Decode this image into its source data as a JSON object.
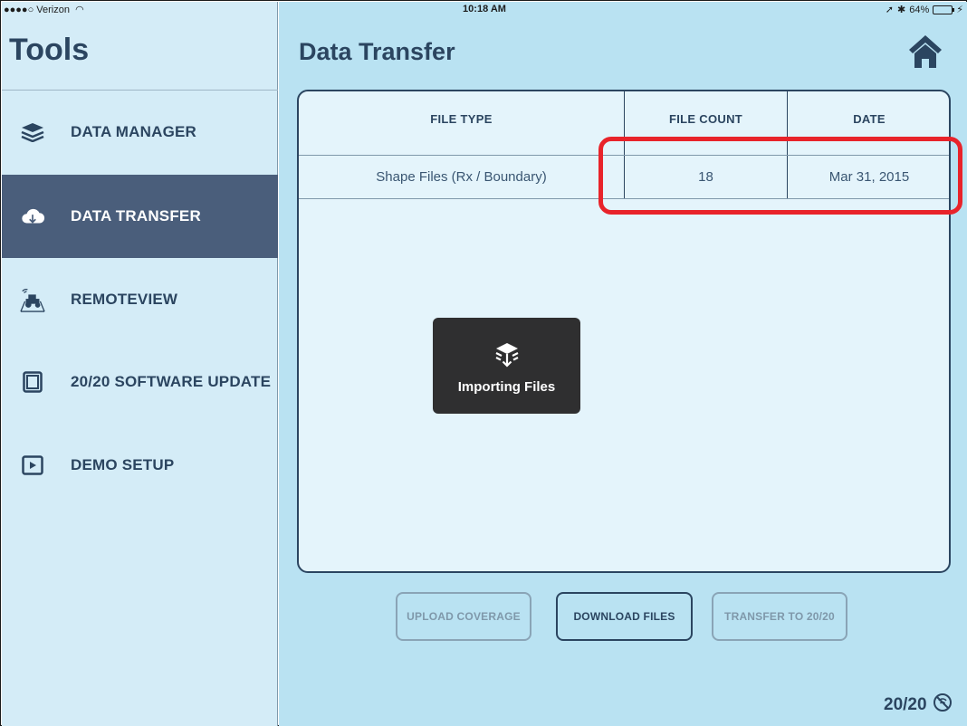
{
  "status_bar": {
    "carrier": "●●●●○ Verizon",
    "time": "10:18 AM",
    "battery": "64%",
    "battery_level": 0.64
  },
  "sidebar": {
    "title": "Tools",
    "items": [
      {
        "label": "DATA MANAGER",
        "icon": "layers-icon",
        "active": false
      },
      {
        "label": "DATA TRANSFER",
        "icon": "cloud-download-icon",
        "active": true
      },
      {
        "label": "REMOTEVIEW",
        "icon": "tractor-icon",
        "active": false
      },
      {
        "label": "20/20 SOFTWARE UPDATE",
        "icon": "display-icon",
        "active": false
      },
      {
        "label": "DEMO SETUP",
        "icon": "play-icon",
        "active": false
      }
    ]
  },
  "main": {
    "title": "Data Transfer",
    "home_icon": "home-icon",
    "table": {
      "headers": [
        "FILE TYPE",
        "FILE COUNT",
        "DATE"
      ],
      "rows": [
        {
          "file_type": "Shape Files (Rx / Boundary)",
          "file_count": "18",
          "date": "Mar 31, 2015"
        }
      ]
    },
    "toast": {
      "label": "Importing Files",
      "icon": "import-layers-icon"
    },
    "buttons": {
      "upload": "UPLOAD COVERAGE",
      "download": "DOWNLOAD FILES",
      "transfer": "TRANSFER TO 20/20"
    },
    "version": "20/20"
  },
  "colors": {
    "sidebar_bg": "#d4ecf7",
    "main_bg": "#b9e2f2",
    "active_bg": "#4a5e7b",
    "text_primary": "#2b4560",
    "highlight": "#e8232a"
  }
}
